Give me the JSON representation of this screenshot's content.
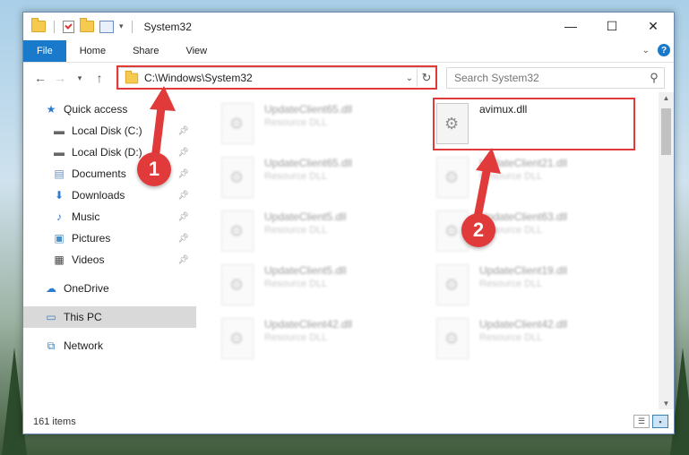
{
  "window": {
    "title": "System32"
  },
  "ribbon": {
    "tabs": [
      "File",
      "Home",
      "Share",
      "View"
    ]
  },
  "address": {
    "path": "C:\\Windows\\System32"
  },
  "search": {
    "placeholder": "Search System32"
  },
  "sidebar": {
    "quick_access": "Quick access",
    "items": [
      {
        "label": "Local Disk (C:)",
        "icon": "drive-icon"
      },
      {
        "label": "Local Disk (D:)",
        "icon": "drive-icon"
      },
      {
        "label": "Documents",
        "icon": "documents-icon"
      },
      {
        "label": "Downloads",
        "icon": "downloads-icon"
      },
      {
        "label": "Music",
        "icon": "music-icon"
      },
      {
        "label": "Pictures",
        "icon": "pictures-icon"
      },
      {
        "label": "Videos",
        "icon": "videos-icon"
      }
    ],
    "onedrive": "OneDrive",
    "thispc": "This PC",
    "network": "Network"
  },
  "files": {
    "highlighted": {
      "name": "avimux.dll"
    },
    "left": [
      {
        "name": "UpdateClient65.dll",
        "type": "Resource DLL"
      },
      {
        "name": "UpdateClient65.dll",
        "type": "Resource DLL"
      },
      {
        "name": "UpdateClient5.dll",
        "type": "Resource DLL"
      },
      {
        "name": "UpdateClient5.dll",
        "type": "Resource DLL"
      },
      {
        "name": "UpdateClient42.dll",
        "type": "Resource DLL"
      }
    ],
    "right": [
      {
        "name": "UpdateClient21.dll",
        "type": "Resource DLL"
      },
      {
        "name": "UpdateClient63.dll",
        "type": "Resource DLL"
      },
      {
        "name": "UpdateClient19.dll",
        "type": "Resource DLL"
      },
      {
        "name": "UpdateClient42.dll",
        "type": "Resource DLL"
      }
    ]
  },
  "status": {
    "count": "161 items"
  },
  "callouts": {
    "one": "1",
    "two": "2"
  },
  "colors": {
    "accent": "#1979ca",
    "callout": "#e03a3a"
  }
}
